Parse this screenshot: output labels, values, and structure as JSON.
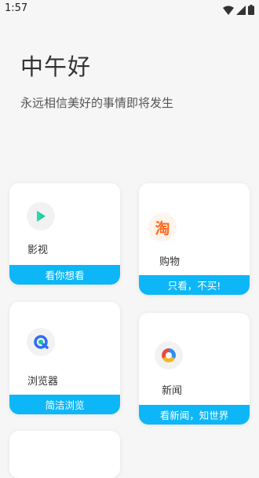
{
  "status_bar": {
    "time": "1:57"
  },
  "header": {
    "greeting": "中午好",
    "subtitle": "永远相信美好的事情即将发生"
  },
  "cards": [
    {
      "label": "影视",
      "tagline": "看你想看",
      "icon": "play-icon"
    },
    {
      "label": "购物",
      "tagline": "只看，不买!",
      "icon": "taobao-icon"
    },
    {
      "label": "浏览器",
      "tagline": "简洁浏览",
      "icon": "browser-icon"
    },
    {
      "label": "新闻",
      "tagline": "看新闻，知世界",
      "icon": "news-icon"
    }
  ],
  "colors": {
    "accent": "#0db7f7",
    "background": "#f6f6f6",
    "taobao_orange": "#ff6a1a"
  }
}
